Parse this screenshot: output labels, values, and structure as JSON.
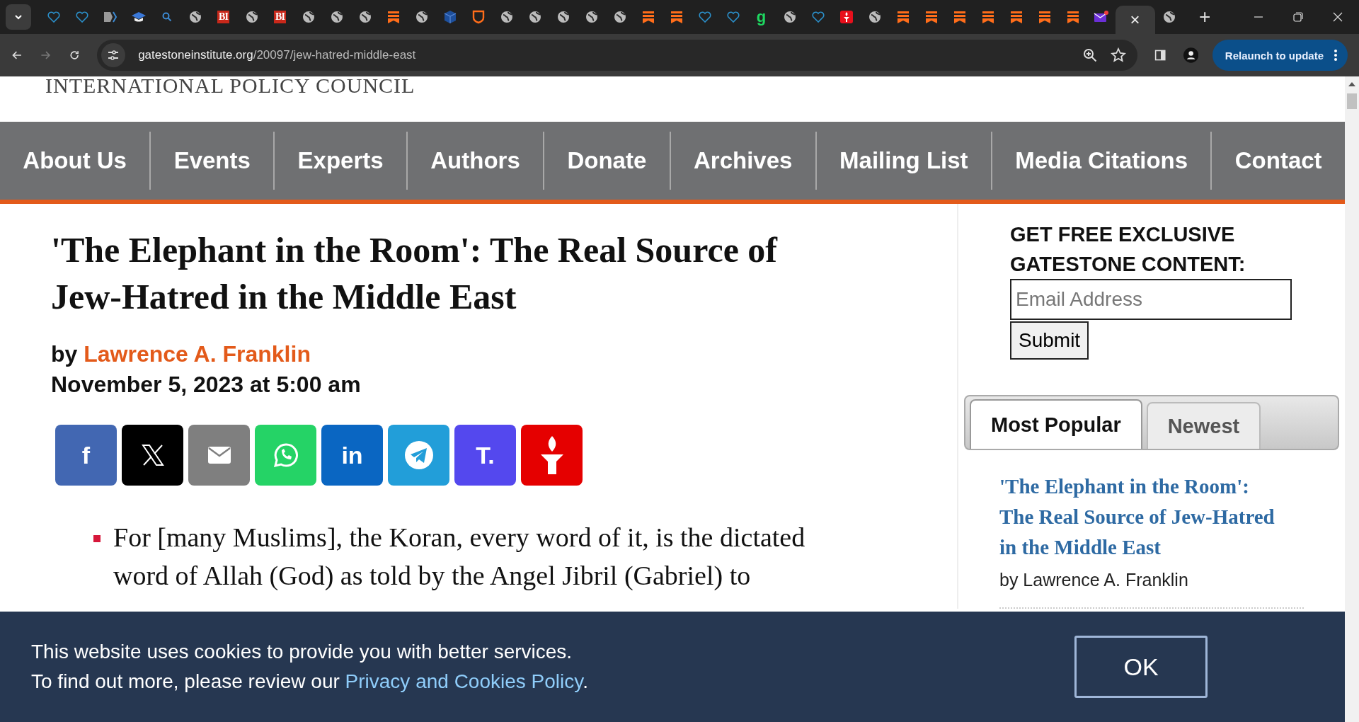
{
  "browser": {
    "tabs": [
      {
        "kind": "heart",
        "selected": false
      },
      {
        "kind": "heart",
        "selected": false
      },
      {
        "kind": "doc",
        "selected": false
      },
      {
        "kind": "cap",
        "selected": false
      },
      {
        "kind": "search",
        "selected": false
      },
      {
        "kind": "globe",
        "selected": false
      },
      {
        "kind": "letter",
        "text": "BI",
        "selected": false
      },
      {
        "kind": "globe",
        "selected": false
      },
      {
        "kind": "letter",
        "text": "BI",
        "selected": false
      },
      {
        "kind": "globe",
        "selected": false
      },
      {
        "kind": "globe",
        "selected": false
      },
      {
        "kind": "globe",
        "selected": false
      },
      {
        "kind": "bookmark",
        "selected": false
      },
      {
        "kind": "globe",
        "selected": false
      },
      {
        "kind": "cube",
        "selected": false
      },
      {
        "kind": "shield",
        "selected": false
      },
      {
        "kind": "globe",
        "selected": false
      },
      {
        "kind": "globe",
        "selected": false
      },
      {
        "kind": "globe",
        "selected": false
      },
      {
        "kind": "globe",
        "selected": false
      },
      {
        "kind": "globe",
        "selected": false
      },
      {
        "kind": "bookmark",
        "selected": false
      },
      {
        "kind": "bookmark",
        "selected": false
      },
      {
        "kind": "heart",
        "selected": false
      },
      {
        "kind": "heart",
        "selected": false
      },
      {
        "kind": "g",
        "text": "g",
        "selected": false
      },
      {
        "kind": "globe",
        "selected": false
      },
      {
        "kind": "heart",
        "selected": false
      },
      {
        "kind": "torch",
        "selected": false
      },
      {
        "kind": "globe",
        "selected": false
      },
      {
        "kind": "bookmark",
        "selected": false
      },
      {
        "kind": "bookmark",
        "selected": false
      },
      {
        "kind": "bookmark",
        "selected": false
      },
      {
        "kind": "bookmark",
        "selected": false
      },
      {
        "kind": "bookmark",
        "selected": false
      },
      {
        "kind": "bookmark",
        "selected": false
      },
      {
        "kind": "bookmark",
        "selected": false
      },
      {
        "kind": "mail",
        "selected": false
      },
      {
        "kind": "close",
        "text": "×",
        "selected": true
      },
      {
        "kind": "globe",
        "selected": false
      }
    ],
    "new_tab": "+",
    "url_host": "gatestoneinstitute.org",
    "url_path": "/20097/jew-hatred-middle-east",
    "relaunch": "Relaunch to update"
  },
  "header": {
    "org": "INTERNATIONAL POLICY COUNCIL"
  },
  "nav": [
    "About Us",
    "Events",
    "Experts",
    "Authors",
    "Donate",
    "Archives",
    "Mailing List",
    "Media Citations",
    "Contact"
  ],
  "article": {
    "title": "'The Elephant in the Room': The Real Source of Jew-Hatred in the Middle East",
    "by": "by",
    "author": "Lawrence A. Franklin",
    "date": "November 5, 2023 at 5:00 am",
    "share": [
      {
        "kind": "letter",
        "text": "f",
        "color": "#4267b2"
      },
      {
        "kind": "x",
        "color": "#000000"
      },
      {
        "kind": "email",
        "color": "#7f7f7f"
      },
      {
        "kind": "chat",
        "color": "#25d366"
      },
      {
        "kind": "letter",
        "text": "in",
        "color": "#0a66c2"
      },
      {
        "kind": "plane",
        "color": "#229ed9"
      },
      {
        "kind": "letter",
        "text": "T.",
        "color": "#5448ee"
      },
      {
        "kind": "torch",
        "color": "#e50000"
      }
    ],
    "bullets": [
      "For [many Muslims], the Koran, every word of it, is the dictated word of Allah (God) as told by the Angel Jibril (Gabriel) to"
    ]
  },
  "sidebar": {
    "signup_title": "GET FREE EXCLUSIVE GATESTONE CONTENT:",
    "email_placeholder": "Email Address",
    "submit": "Submit",
    "tabs": [
      {
        "label": "Most Popular",
        "selected": true
      },
      {
        "label": "Newest",
        "selected": false
      }
    ],
    "items": [
      {
        "title": "'The Elephant in the Room': The Real Source of Jew-Hatred in the Middle East",
        "byline": "by Lawrence A. Franklin"
      }
    ]
  },
  "cookie": {
    "line1": "This website uses cookies to provide you with better services.",
    "line2": "To find out more, please review our ",
    "link": "Privacy and Cookies Policy",
    "line2_end": ".",
    "ok": "OK"
  }
}
